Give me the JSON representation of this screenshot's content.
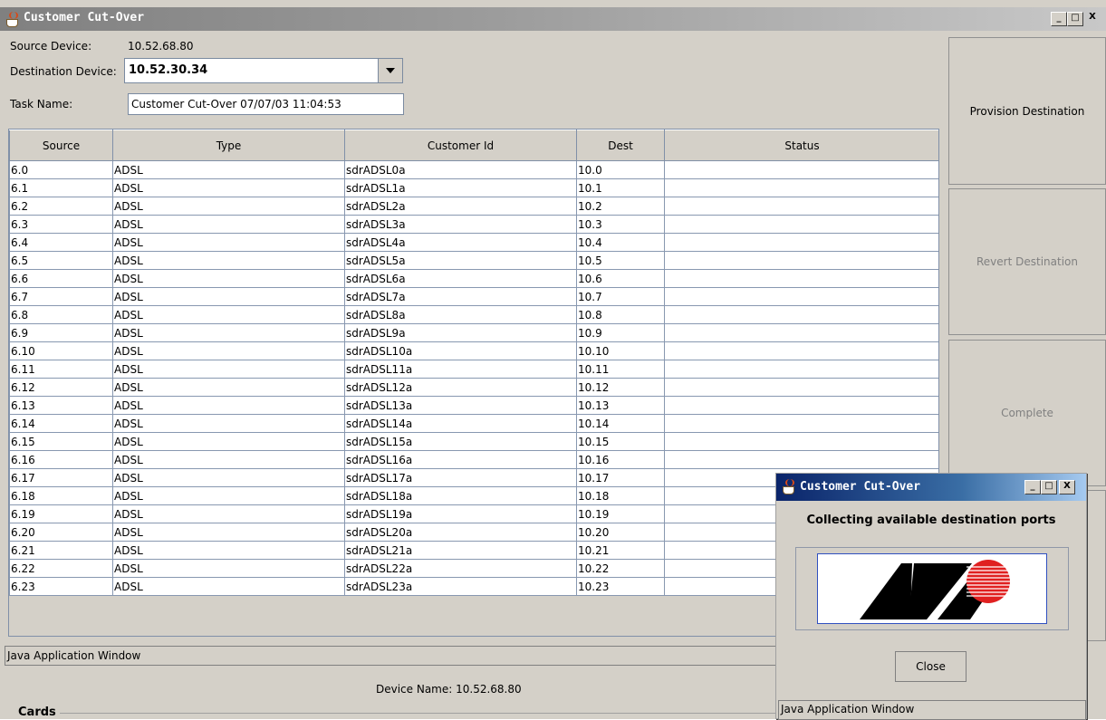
{
  "window": {
    "title": "Customer Cut-Over",
    "controls": [
      "_",
      "□",
      "X"
    ]
  },
  "form": {
    "source_label": "Source Device:",
    "source_value": "10.52.68.80",
    "dest_label": "Destination Device:",
    "dest_value": "10.52.30.34",
    "task_label": "Task Name:",
    "task_value": "Customer Cut-Over 07/07/03 11:04:53"
  },
  "table": {
    "columns": [
      "Source",
      "Type",
      "Customer Id",
      "Dest",
      "Status"
    ],
    "rows": [
      [
        "6.0",
        "ADSL",
        "sdrADSL0a",
        "10.0",
        ""
      ],
      [
        "6.1",
        "ADSL",
        "sdrADSL1a",
        "10.1",
        ""
      ],
      [
        "6.2",
        "ADSL",
        "sdrADSL2a",
        "10.2",
        ""
      ],
      [
        "6.3",
        "ADSL",
        "sdrADSL3a",
        "10.3",
        ""
      ],
      [
        "6.4",
        "ADSL",
        "sdrADSL4a",
        "10.4",
        ""
      ],
      [
        "6.5",
        "ADSL",
        "sdrADSL5a",
        "10.5",
        ""
      ],
      [
        "6.6",
        "ADSL",
        "sdrADSL6a",
        "10.6",
        ""
      ],
      [
        "6.7",
        "ADSL",
        "sdrADSL7a",
        "10.7",
        ""
      ],
      [
        "6.8",
        "ADSL",
        "sdrADSL8a",
        "10.8",
        ""
      ],
      [
        "6.9",
        "ADSL",
        "sdrADSL9a",
        "10.9",
        ""
      ],
      [
        "6.10",
        "ADSL",
        "sdrADSL10a",
        "10.10",
        ""
      ],
      [
        "6.11",
        "ADSL",
        "sdrADSL11a",
        "10.11",
        ""
      ],
      [
        "6.12",
        "ADSL",
        "sdrADSL12a",
        "10.12",
        ""
      ],
      [
        "6.13",
        "ADSL",
        "sdrADSL13a",
        "10.13",
        ""
      ],
      [
        "6.14",
        "ADSL",
        "sdrADSL14a",
        "10.14",
        ""
      ],
      [
        "6.15",
        "ADSL",
        "sdrADSL15a",
        "10.15",
        ""
      ],
      [
        "6.16",
        "ADSL",
        "sdrADSL16a",
        "10.16",
        ""
      ],
      [
        "6.17",
        "ADSL",
        "sdrADSL17a",
        "10.17",
        ""
      ],
      [
        "6.18",
        "ADSL",
        "sdrADSL18a",
        "10.18",
        ""
      ],
      [
        "6.19",
        "ADSL",
        "sdrADSL19a",
        "10.19",
        ""
      ],
      [
        "6.20",
        "ADSL",
        "sdrADSL20a",
        "10.20",
        ""
      ],
      [
        "6.21",
        "ADSL",
        "sdrADSL21a",
        "10.21",
        ""
      ],
      [
        "6.22",
        "ADSL",
        "sdrADSL22a",
        "10.22",
        ""
      ],
      [
        "6.23",
        "ADSL",
        "sdrADSL23a",
        "10.23",
        ""
      ]
    ]
  },
  "buttons": {
    "provision": "Provision Destination",
    "revert": "Revert Destination",
    "complete": "Complete"
  },
  "status_bar": "Java Application Window",
  "lower": {
    "device_name": "Device Name:  10.52.68.80",
    "cards_label": "Cards"
  },
  "dialog": {
    "title": "Customer Cut-Over",
    "message": "Collecting available destination ports",
    "close_label": "Close",
    "status": "Java Application Window"
  },
  "colors": {
    "window_bg": "#d4d0c8",
    "dialog_title": "#0a246a",
    "logo_red": "#e02020"
  },
  "icons": {
    "app_icon": "java-cup-icon"
  }
}
